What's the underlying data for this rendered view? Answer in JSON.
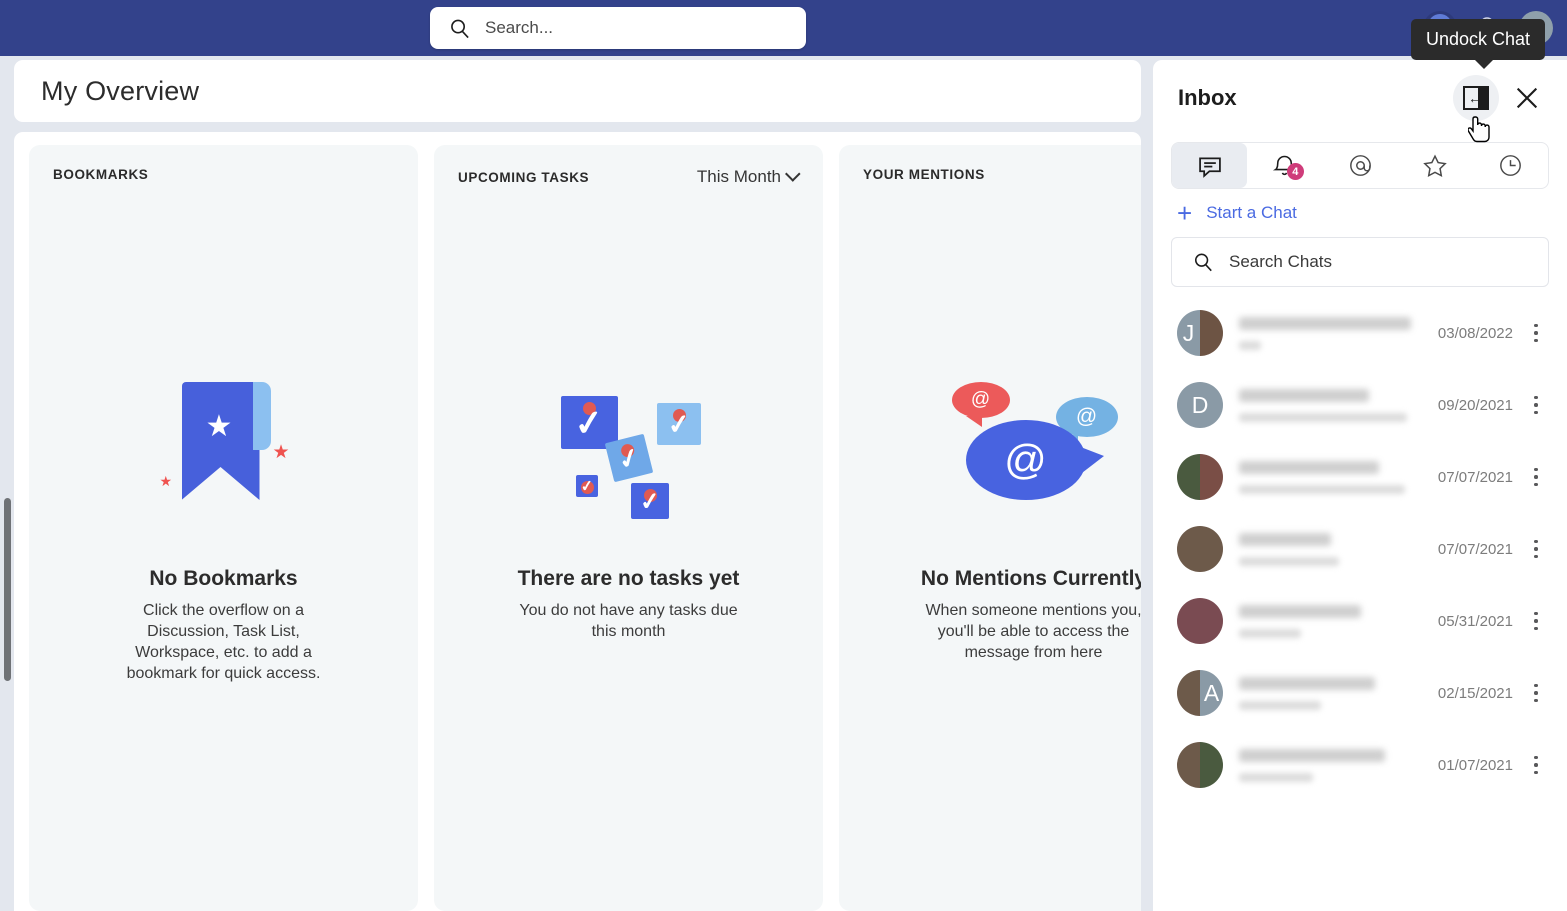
{
  "topbar": {
    "search_placeholder": "Search...",
    "avatar_name": "user-avatar",
    "notifications_icon": "bell-icon",
    "tooltip": "Undock Chat"
  },
  "page": {
    "title": "My Overview"
  },
  "cards": [
    {
      "title": "BOOKMARKS",
      "filter": null,
      "empty_title": "No Bookmarks",
      "empty_sub": "Click the overflow on a Discussion, Task List, Workspace, etc. to add a bookmark for quick access.",
      "illustration": "bookmark-ribbon-illustration"
    },
    {
      "title": "UPCOMING TASKS",
      "filter": "This Month",
      "empty_title": "There are no tasks yet",
      "empty_sub": "You do not have any tasks due this month",
      "illustration": "task-notes-illustration"
    },
    {
      "title": "YOUR MENTIONS",
      "filter": null,
      "empty_title": "No Mentions Currently",
      "empty_sub": "When someone mentions you, you'll be able to access the message from here",
      "illustration": "mention-bubbles-illustration"
    }
  ],
  "inbox": {
    "title": "Inbox",
    "undock_label": "undock-chat-icon",
    "close_label": "close-icon",
    "tabs": [
      {
        "name": "chats",
        "icon": "chat-bubble-icon",
        "active": true,
        "badge": null
      },
      {
        "name": "notifications",
        "icon": "bell-icon",
        "active": false,
        "badge": "4"
      },
      {
        "name": "mentions",
        "icon": "at-icon",
        "active": false,
        "badge": null
      },
      {
        "name": "starred",
        "icon": "star-icon",
        "active": false,
        "badge": null
      },
      {
        "name": "history",
        "icon": "clock-icon",
        "active": false,
        "badge": null
      }
    ],
    "start_chat": "Start a Chat",
    "search_placeholder": "Search Chats",
    "chats": [
      {
        "date": "03/08/2022",
        "avatar_kind": "letter-photo",
        "letter": "J",
        "letter_bg": "#8a9aa6",
        "photo_a": "#3b2f2a",
        "photo_b": "#6d5444",
        "name_w": 172,
        "prev_w": 22
      },
      {
        "date": "09/20/2021",
        "avatar_kind": "letter",
        "letter": "D",
        "letter_bg": "#8a9aa6",
        "photo_a": "#8a9aa6",
        "photo_b": "#8a9aa6",
        "name_w": 130,
        "prev_w": 168
      },
      {
        "date": "07/07/2021",
        "avatar_kind": "photo-photo",
        "letter": "",
        "letter_bg": "#8a9aa6",
        "photo_a": "#4a5a3f",
        "photo_b": "#7a4e46",
        "name_w": 140,
        "prev_w": 166
      },
      {
        "date": "07/07/2021",
        "avatar_kind": "photo",
        "letter": "",
        "letter_bg": "#8a9aa6",
        "photo_a": "#6d5a4a",
        "photo_b": "#6d5a4a",
        "name_w": 92,
        "prev_w": 100
      },
      {
        "date": "05/31/2021",
        "avatar_kind": "photo",
        "letter": "",
        "letter_bg": "#8a9aa6",
        "photo_a": "#7a4b52",
        "photo_b": "#7a4b52",
        "name_w": 122,
        "prev_w": 62
      },
      {
        "date": "02/15/2021",
        "avatar_kind": "photo-letter",
        "letter": "A",
        "letter_bg": "#8a9aa6",
        "photo_a": "#6d5a4a",
        "photo_b": "#8a9aa6",
        "name_w": 136,
        "prev_w": 82
      },
      {
        "date": "01/07/2021",
        "avatar_kind": "photo-photo",
        "letter": "",
        "letter_bg": "#8a9aa6",
        "photo_a": "#6d5a4a",
        "photo_b": "#4a5a3f",
        "name_w": 146,
        "prev_w": 74
      }
    ]
  },
  "colors": {
    "topbar": "#33428b",
    "page_bg": "#e3e7ee",
    "card_bg": "#f4f7f8",
    "accent_blue": "#4863e0",
    "link_blue": "#4a6ae2",
    "badge_pink": "#cf3c7a",
    "tooltip_bg": "#2b2b2b"
  }
}
